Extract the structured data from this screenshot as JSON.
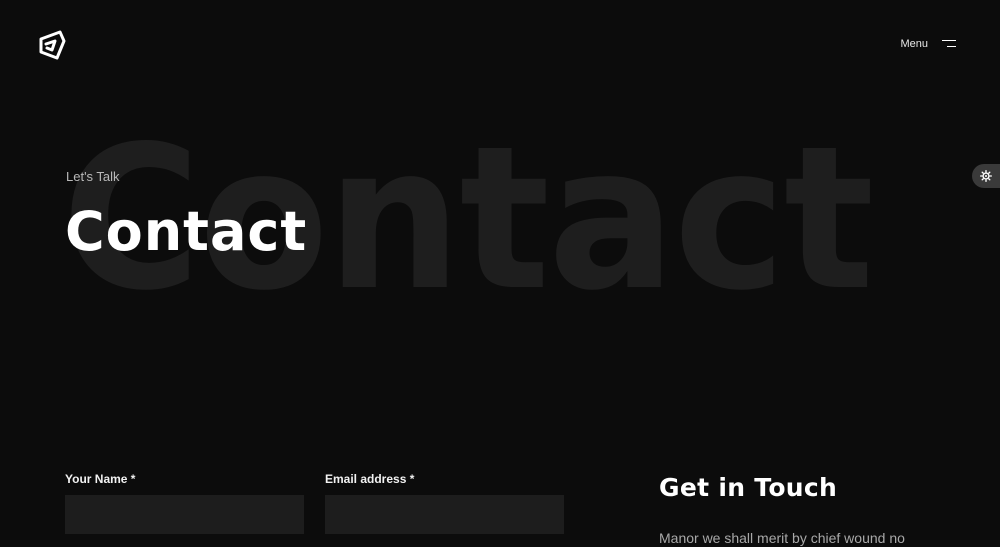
{
  "header": {
    "logo_icon": "brand-logo-icon",
    "menu_label": "Menu",
    "menu_icon": "hamburger-icon"
  },
  "settings": {
    "icon": "gear-icon"
  },
  "hero": {
    "background_word": "Contact",
    "eyebrow": "Let's Talk",
    "title": "Contact"
  },
  "form": {
    "name_label": "Your Name *",
    "email_label": "Email address *"
  },
  "contact_info": {
    "title": "Get in Touch",
    "text": "Manor we shall merit by chief wound no"
  },
  "colors": {
    "background": "#0c0c0c",
    "background_word": "#1e1e1e",
    "field": "#1d1d1d"
  }
}
